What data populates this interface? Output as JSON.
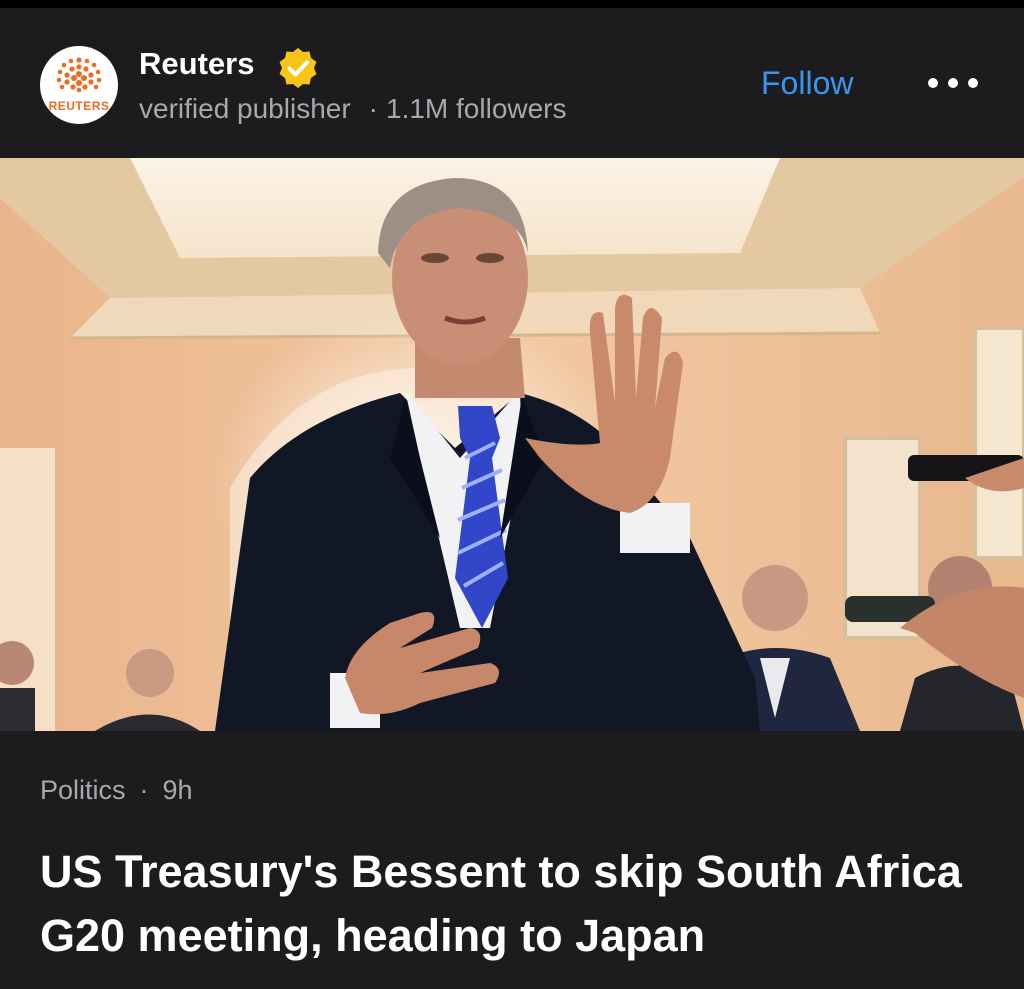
{
  "publisher": {
    "name": "Reuters",
    "logo_text": "REUTERS",
    "subtitle": "verified publisher",
    "followers": "1.1M followers",
    "follow_label": "Follow"
  },
  "article": {
    "category": "Politics",
    "age": "9h",
    "headline": "US Treasury's Bessent to skip South Africa G20 meeting, heading to Japan"
  },
  "icons": {
    "verified": "verified-badge-icon",
    "more": "more-options-icon"
  },
  "colors": {
    "background": "#1c1c1e",
    "accent": "#3b95f5",
    "secondary_text": "#a8a8ad",
    "badge": "#f5c518",
    "logo_orange": "#f06a22"
  }
}
